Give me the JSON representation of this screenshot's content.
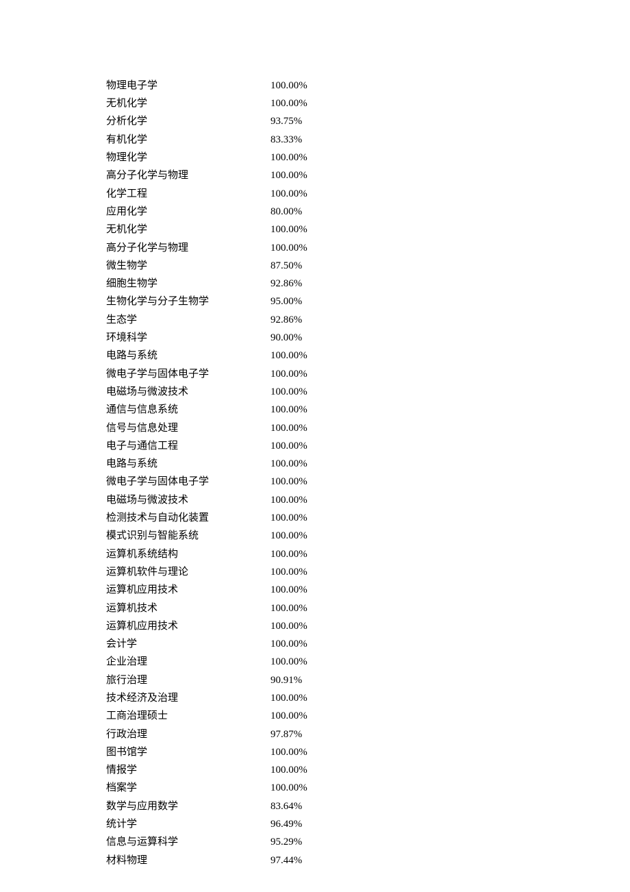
{
  "rows": [
    {
      "subject": "物理电子学",
      "percent": "100.00%"
    },
    {
      "subject": "无机化学",
      "percent": "100.00%"
    },
    {
      "subject": "分析化学",
      "percent": "93.75%"
    },
    {
      "subject": "有机化学",
      "percent": "83.33%"
    },
    {
      "subject": "物理化学",
      "percent": "100.00%"
    },
    {
      "subject": "高分子化学与物理",
      "percent": "100.00%"
    },
    {
      "subject": "化学工程",
      "percent": "100.00%"
    },
    {
      "subject": "应用化学",
      "percent": "80.00%"
    },
    {
      "subject": "无机化学",
      "percent": "100.00%"
    },
    {
      "subject": "高分子化学与物理",
      "percent": "100.00%"
    },
    {
      "subject": "微生物学",
      "percent": "87.50%"
    },
    {
      "subject": "细胞生物学",
      "percent": "92.86%"
    },
    {
      "subject": "生物化学与分子生物学",
      "percent": "95.00%"
    },
    {
      "subject": "生态学",
      "percent": "92.86%"
    },
    {
      "subject": "环境科学",
      "percent": "90.00%"
    },
    {
      "subject": "电路与系统",
      "percent": "100.00%"
    },
    {
      "subject": "微电子学与固体电子学",
      "percent": "100.00%"
    },
    {
      "subject": "电磁场与微波技术",
      "percent": "100.00%"
    },
    {
      "subject": "通信与信息系统",
      "percent": "100.00%"
    },
    {
      "subject": "信号与信息处理",
      "percent": "100.00%"
    },
    {
      "subject": "电子与通信工程",
      "percent": "100.00%"
    },
    {
      "subject": "电路与系统",
      "percent": "100.00%"
    },
    {
      "subject": "微电子学与固体电子学",
      "percent": "100.00%"
    },
    {
      "subject": "电磁场与微波技术",
      "percent": "100.00%"
    },
    {
      "subject": "检测技术与自动化装置",
      "percent": "100.00%"
    },
    {
      "subject": "模式识别与智能系统",
      "percent": "100.00%"
    },
    {
      "subject": "运算机系统结构",
      "percent": "100.00%"
    },
    {
      "subject": "运算机软件与理论",
      "percent": "100.00%"
    },
    {
      "subject": "运算机应用技术",
      "percent": "100.00%"
    },
    {
      "subject": "运算机技术",
      "percent": "100.00%"
    },
    {
      "subject": "运算机应用技术",
      "percent": "100.00%"
    },
    {
      "subject": "会计学",
      "percent": "100.00%"
    },
    {
      "subject": "企业治理",
      "percent": "100.00%"
    },
    {
      "subject": "旅行治理",
      "percent": "90.91%"
    },
    {
      "subject": "技术经济及治理",
      "percent": "100.00%"
    },
    {
      "subject": "工商治理硕士",
      "percent": "100.00%"
    },
    {
      "subject": "行政治理",
      "percent": "97.87%"
    },
    {
      "subject": "图书馆学",
      "percent": "100.00%"
    },
    {
      "subject": "情报学",
      "percent": "100.00%"
    },
    {
      "subject": "档案学",
      "percent": "100.00%"
    },
    {
      "subject": "数学与应用数学",
      "percent": "83.64%"
    },
    {
      "subject": "统计学",
      "percent": "96.49%"
    },
    {
      "subject": "信息与运算科学",
      "percent": "95.29%"
    },
    {
      "subject": "材料物理",
      "percent": "97.44%"
    }
  ]
}
